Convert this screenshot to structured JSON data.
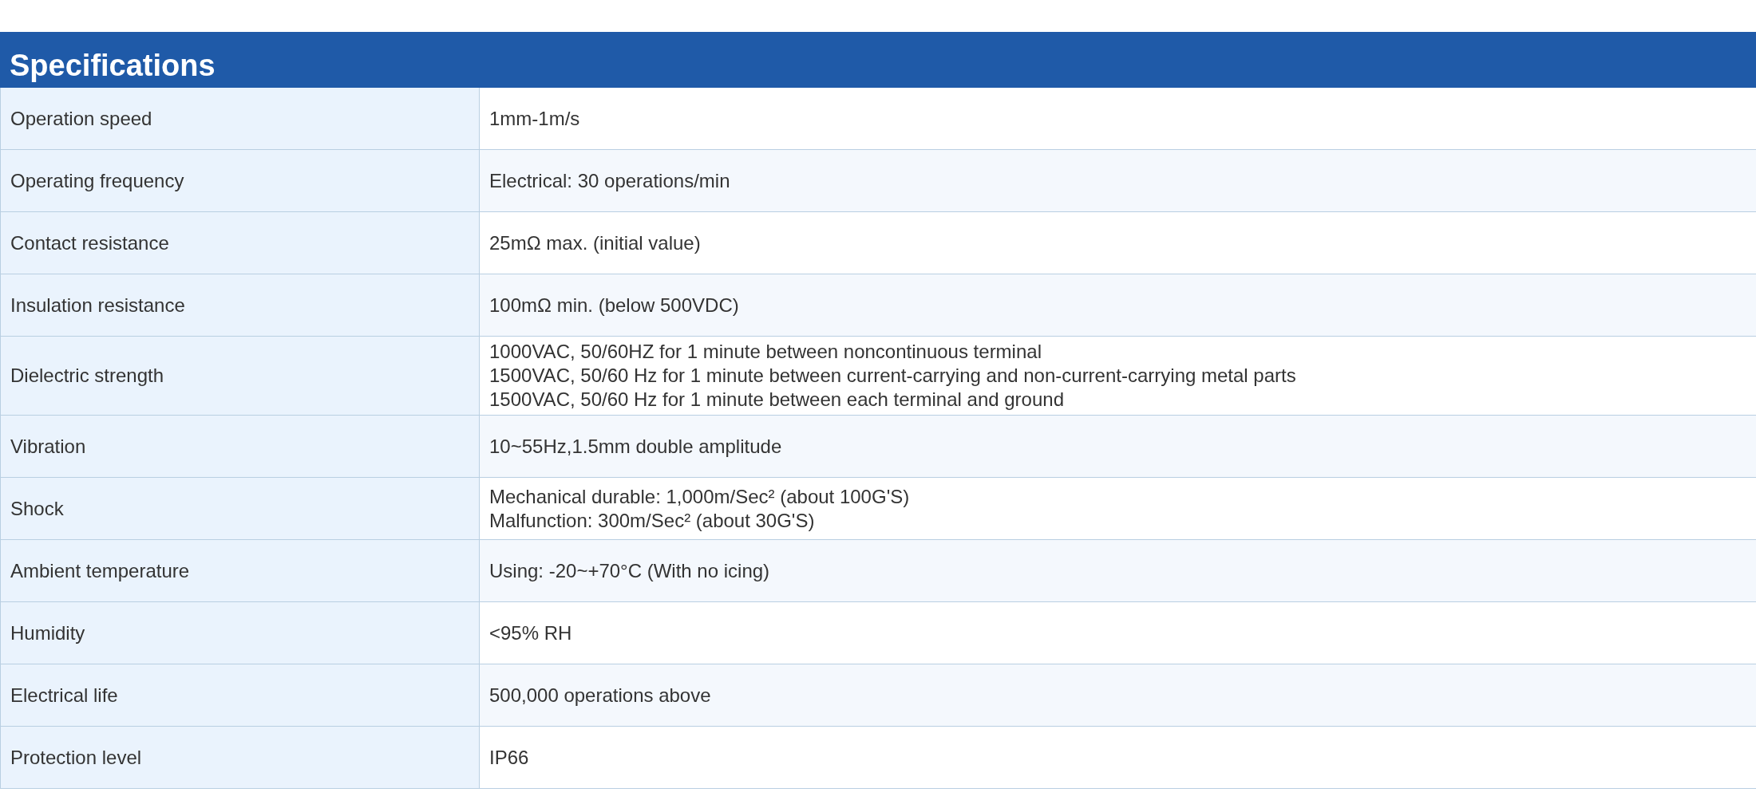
{
  "title": "Specifications",
  "rows": [
    {
      "label": "Operation speed",
      "value": [
        "1mm-1m/s"
      ]
    },
    {
      "label": "Operating frequency",
      "value": [
        "Electrical: 30 operations/min"
      ]
    },
    {
      "label": "Contact resistance",
      "value": [
        "25mΩ max. (initial value)"
      ]
    },
    {
      "label": "Insulation resistance",
      "value": [
        "100mΩ min. (below 500VDC)"
      ]
    },
    {
      "label": "Dielectric strength",
      "value": [
        "1000VAC, 50/60HZ for 1 minute between noncontinuous terminal",
        "1500VAC, 50/60 Hz for 1 minute between current-carrying and non-current-carrying metal parts",
        "1500VAC, 50/60 Hz for 1 minute between each terminal and ground"
      ]
    },
    {
      "label": "Vibration",
      "value": [
        "10~55Hz,1.5mm double amplitude"
      ]
    },
    {
      "label": "Shock",
      "value": [
        "Mechanical durable: 1,000m/Sec² (about 100G'S)",
        "Malfunction: 300m/Sec² (about 30G'S)"
      ]
    },
    {
      "label": "Ambient temperature",
      "value": [
        "Using: -20~+70°C (With no icing)"
      ]
    },
    {
      "label": "Humidity",
      "value": [
        "<95% RH"
      ]
    },
    {
      "label": "Electrical life",
      "value": [
        "500,000 operations above"
      ]
    },
    {
      "label": "Protection level",
      "value": [
        "IP66"
      ]
    }
  ]
}
